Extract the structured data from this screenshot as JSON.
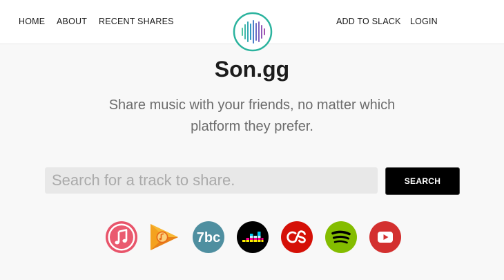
{
  "nav": {
    "home": "HOME",
    "about": "ABOUT",
    "recent_shares": "RECENT SHARES",
    "add_to_slack": "ADD TO SLACK",
    "login": "LOGIN"
  },
  "hero": {
    "title": "Son.gg",
    "subtitle": "Share music with your friends, no matter which platform they prefer."
  },
  "search": {
    "placeholder": "Search for a track to share.",
    "value": "",
    "button_label": "SEARCH"
  },
  "platforms": [
    {
      "icon": "apple-music-icon",
      "color": "#e8546a"
    },
    {
      "icon": "google-play-music-icon",
      "color": "#f29b1e"
    },
    {
      "icon": "7digital-icon",
      "color": "#4f8fa0",
      "label": "7bc"
    },
    {
      "icon": "deezer-icon",
      "color": "#000000"
    },
    {
      "icon": "lastfm-icon",
      "color": "#d51007"
    },
    {
      "icon": "spotify-icon",
      "color": "#84bd00"
    },
    {
      "icon": "youtube-icon",
      "color": "#d3302f"
    }
  ],
  "colors": {
    "logo": "#2bb39e",
    "page_bg": "#f8f8f8",
    "button_bg": "#000000"
  }
}
